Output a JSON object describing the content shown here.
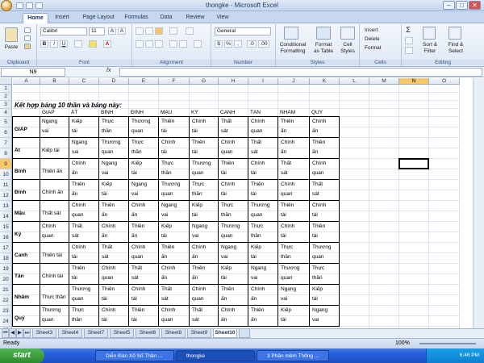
{
  "window": {
    "title": "thongke - Microsoft Excel",
    "min": "–",
    "max": "□",
    "close": "✕"
  },
  "ribbon_tabs": [
    "Home",
    "Insert",
    "Page Layout",
    "Formulas",
    "Data",
    "Review",
    "View"
  ],
  "ribbon": {
    "clipboard": {
      "label": "Clipboard",
      "paste": "Paste"
    },
    "font": {
      "label": "Font",
      "family": "Calibri",
      "size": "11",
      "grow": "A",
      "shrink": "A",
      "bold": "B",
      "italic": "I",
      "underline": "U",
      "color_a": "A"
    },
    "alignment": {
      "label": "Alignment"
    },
    "number": {
      "label": "Number",
      "format": "General",
      "currency": "$",
      "percent": "%",
      "comma": ",",
      "inc": ".0",
      "dec": ".00"
    },
    "styles": {
      "label": "Styles",
      "cond": "Conditional",
      "cond2": "Formatting",
      "fmt": "Format",
      "fmt2": "as Table",
      "cell": "Cell",
      "cell2": "Styles"
    },
    "cells": {
      "label": "Cells",
      "insert": "Insert",
      "delete": "Delete",
      "format": "Format"
    },
    "editing": {
      "label": "Editing",
      "sum": "Σ",
      "sort": "Sort &",
      "sort2": "Filter",
      "find": "Find &",
      "find2": "Select"
    }
  },
  "formula_bar": {
    "name_box": "N9",
    "fx": "fx",
    "value": ""
  },
  "columns": [
    "A",
    "B",
    "C",
    "D",
    "E",
    "F",
    "G",
    "H",
    "I",
    "J",
    "K",
    "L",
    "M",
    "N",
    "O"
  ],
  "selected_col": "N",
  "selected_row": "9",
  "rows": [
    "1",
    "2",
    "3",
    "4",
    "5",
    "6",
    "7",
    "8",
    "9",
    "10",
    "11",
    "12",
    "13",
    "14",
    "15",
    "16",
    "17",
    "18",
    "19",
    "20",
    "21",
    "22",
    "23",
    "24",
    "25",
    "26"
  ],
  "sheet": {
    "heading": "Kết hợp bảng 10 thần và bảng này:",
    "col_headers": [
      "GIÁP",
      "ẤT",
      "BÍNH",
      "ĐINH",
      "MẬU",
      "KỶ",
      "CANH",
      "TÂN",
      "NHÂM",
      "QUÝ"
    ],
    "row_labels": [
      "GIÁP",
      "Ất",
      "Bính",
      "Đinh",
      "Mậu",
      "Kỷ",
      "Canh",
      "Tân",
      "Nhâm",
      "Quý"
    ],
    "row_label_b": [
      "",
      "Kiếp tài",
      "Thiên ấn",
      "Chính ấn",
      "Thất sát",
      "Chính\nquan",
      "Thiên tài",
      "Chính tài",
      "Thực thần",
      "Thương\nquan"
    ],
    "b_first": "Ngang\nvai",
    "table": [
      [
        "Kiếp\ntài",
        "Thực\nthần",
        "Thương\nquan",
        "Thiên\ntài",
        "Chính\ntài",
        "Thất\nsát",
        "Chính\nquan",
        "Thiên\nấn",
        "Chính\nấn"
      ],
      [
        "Ngang\nvai",
        "Thương\nquan",
        "Thực\nthần",
        "Chính\ntài",
        "Thiên\ntài",
        "Chính\nquan",
        "Thất\nsát",
        "Chính\nấn",
        "Thiên\nấn"
      ],
      [
        "Chính\nấn",
        "Ngang\nvai",
        "Kiếp\ntài",
        "Thực\nthần",
        "Thương\nquan",
        "Thiên\ntài",
        "Chính\ntài",
        "Thất\nsát",
        "Chính\nquan"
      ],
      [
        "Thiên\nấn",
        "Kiếp\ntài",
        "Ngang\nvai",
        "Thương\nquan",
        "Thực\nthần",
        "Chính\ntài",
        "Thiên\ntài",
        "Chính\nquan",
        "Thất\nsát"
      ],
      [
        "Chính\nquan",
        "Thiên\nấn",
        "Chính\nấn",
        "Ngang\nvai",
        "Kiếp\ntài",
        "Thực\nthần",
        "Thương\nquan",
        "Thiên\ntài",
        "Chính\ntài"
      ],
      [
        "Thất\nsát",
        "Chính\nấn",
        "Thiên\nấn",
        "Kiếp\ntài",
        "Ngang\nvai",
        "Thương\nquan",
        "Thực\nthần",
        "Chính\ntài",
        "Thiên\ntài"
      ],
      [
        "Chính\ntài",
        "Thất\nsát",
        "Chính\nquan",
        "Thiên\nấn",
        "Chính\nấn",
        "Ngang\nvai",
        "Kiếp\ntài",
        "Thực\nthần",
        "Thương\nquan"
      ],
      [
        "Thiên\ntài",
        "Chính\nquan",
        "Thất\nsát",
        "Chính\nấn",
        "Thiên\nấn",
        "Kiếp\ntài",
        "Ngang\nvai",
        "Thương\nquan",
        "Thực\nthần"
      ],
      [
        "Thương\nquan",
        "Thiên\ntài",
        "Chính\ntài",
        "Thất\nsát",
        "Chính\nquan",
        "Thiên\nấn",
        "Chính\nấn",
        "Ngang\nvai",
        "Kiếp\ntài"
      ],
      [
        "Thực\nthần",
        "Chính\ntài",
        "Thiên\ntài",
        "Chính\nquan",
        "Thất\nsát",
        "Chính\nấn",
        "Thiên\nấn",
        "Kiếp\ntài",
        "Ngang\nvai"
      ]
    ]
  },
  "sheet_tabs": [
    "Sheet3",
    "Sheet4",
    "Sheet7",
    "Sheet5",
    "Sheet6",
    "Sheet8",
    "Sheet9",
    "Sheet10"
  ],
  "active_sheet": "Sheet10",
  "status": {
    "ready": "Ready",
    "zoom": "100%"
  },
  "taskbar": {
    "start": "start",
    "tasks": [
      "Diễn Đàn Xổ Số Thần ...",
      "thongke",
      "3 Phần mềm Thống ..."
    ],
    "clock": "6:46 PM"
  }
}
